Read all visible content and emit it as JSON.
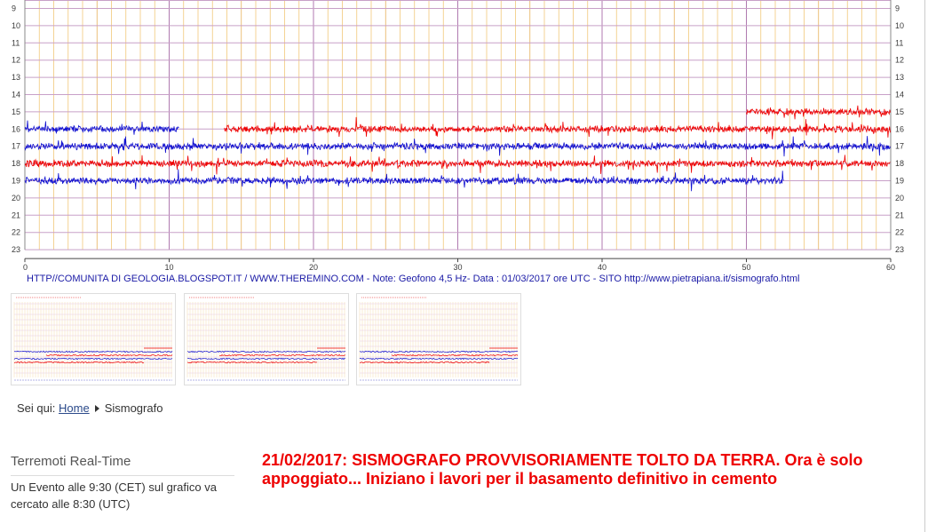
{
  "helicorder": {
    "hour_rows": [
      9,
      10,
      11,
      12,
      13,
      14,
      15,
      16,
      17,
      18,
      19,
      20,
      21,
      22,
      23
    ],
    "minute_ticks": [
      0,
      10,
      20,
      30,
      40,
      50,
      60
    ],
    "traces": [
      {
        "hour": 15,
        "color": "#ee0000",
        "start_min": 50,
        "end_min": 60
      },
      {
        "hour": 16,
        "color": "#1010d0",
        "start_min": 0,
        "end_min": 10.7
      },
      {
        "hour": 16,
        "color": "#ee0000",
        "start_min": 13.8,
        "end_min": 60
      },
      {
        "hour": 17,
        "color": "#1010d0",
        "start_min": 0,
        "end_min": 60
      },
      {
        "hour": 18,
        "color": "#ee0000",
        "start_min": 0,
        "end_min": 60
      },
      {
        "hour": 19,
        "color": "#1010d0",
        "start_min": 0,
        "end_min": 52.6
      }
    ],
    "colors": {
      "grid_minor": "#f2c87a",
      "grid_hour": "#b07ab0",
      "grid_row": "#c8a0c8",
      "label": "#3a3a3a"
    }
  },
  "caption": "HTTP//COMUNITA DI GEOLOGIA.BLOGSPOT.IT  /  WWW.THEREMINO.COM  -  Note: Geofono 4,5 Hz- Data : 01/03/2017 ore UTC - SITO http://www.pietrapiana.it/sismografo.html",
  "thumbnails": [
    {
      "name": "thumb-1"
    },
    {
      "name": "thumb-2"
    },
    {
      "name": "thumb-3"
    }
  ],
  "breadcrumb": {
    "prefix": "Sei qui:",
    "home": "Home",
    "current": "Sismografo"
  },
  "widget": {
    "title": "Terremoti Real-Time",
    "text": "Un Evento alle 9:30 (CET) sul grafico va cercato alle 8:30 (UTC)"
  },
  "notice": "21/02/2017: SISMOGRAFO PROVVISORIAMENTE TOLTO DA TERRA. Ora è solo appoggiato... Iniziano i lavori per il basamento definitivo in cemento",
  "colors": {
    "notice": "#ee0000",
    "link": "#2b4a8a",
    "caption": "#1a1aa6"
  }
}
